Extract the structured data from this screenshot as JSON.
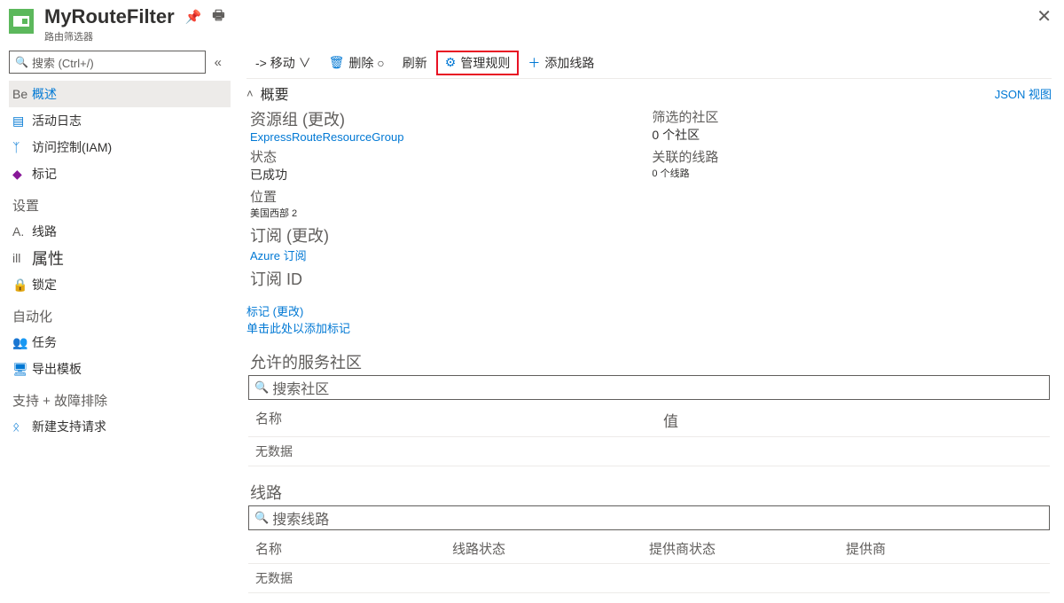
{
  "header": {
    "title": "MyRouteFilter",
    "subtitle": "路由筛选器"
  },
  "sidebar": {
    "search_placeholder": "搜索 (Ctrl+/)",
    "items": [
      {
        "icon": "Be",
        "label": "概述",
        "active": true
      },
      {
        "icon": "log",
        "label": "活动日志"
      },
      {
        "icon": "iam",
        "label": "访问控制(IAM)"
      },
      {
        "icon": "tag",
        "label": "标记"
      }
    ],
    "groups": [
      {
        "title": "设置",
        "items": [
          {
            "icon": "A.",
            "label": "线路"
          },
          {
            "icon": "ill",
            "label": "属性",
            "prop": true
          },
          {
            "icon": "lock",
            "label": "锁定"
          }
        ]
      },
      {
        "title": "自动化",
        "items": [
          {
            "icon": "task",
            "label": "任务"
          },
          {
            "icon": "export",
            "label": "导出模板"
          }
        ]
      },
      {
        "title": "支持 + 故障排除",
        "items": [
          {
            "icon": "support",
            "label": "新建支持请求"
          }
        ]
      }
    ]
  },
  "toolbar": {
    "move": "-> 移动 ∨",
    "delete": "删除 ○",
    "refresh": "刷新",
    "manage_rule": "管理规则",
    "add_circuit": "添加线路"
  },
  "overview": {
    "heading": "概要",
    "json_view": "JSON 视图",
    "left": {
      "resource_group_label": "资源组 (更改)",
      "resource_group_value": "ExpressRouteResourceGroup",
      "status_label": "状态",
      "status_value": "已成功",
      "location_label": "位置",
      "location_value": "美国西部 2",
      "subscription_label": "订阅 (更改)",
      "subscription_value": "Azure 订阅",
      "subscription_id_label": "订阅 ID"
    },
    "right": {
      "filtered_label": "筛选的社区",
      "filtered_value": "0 个社区",
      "associated_label": "关联的线路",
      "associated_value": "0 个线路"
    },
    "tags_change": "标记 (更改)",
    "tags_add": "单击此处以添加标记"
  },
  "communities": {
    "title": "允许的服务社区",
    "search_placeholder": "搜索社区",
    "col_name": "名称",
    "col_value": "值",
    "empty": "无数据"
  },
  "circuits": {
    "title": "线路",
    "search_placeholder": "搜索线路",
    "col_name": "名称",
    "col_circuit_status": "线路状态",
    "col_provider_status": "提供商状态",
    "col_provider": "提供商",
    "empty": "无数据"
  }
}
